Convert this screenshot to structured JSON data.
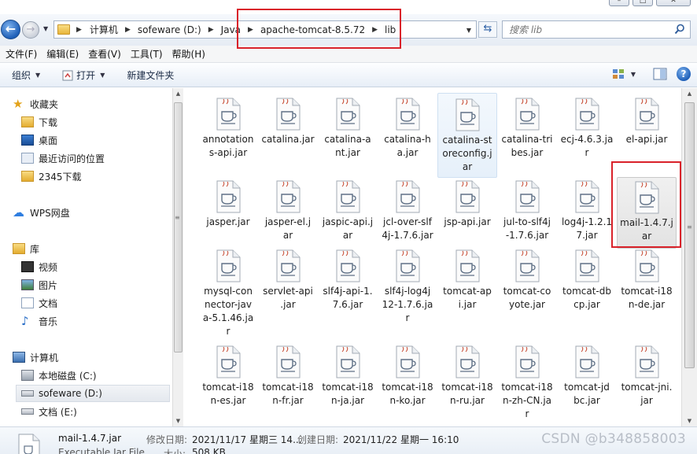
{
  "window": {
    "min_glyph": "–",
    "max_glyph": "□",
    "close_glyph": "✕"
  },
  "address": {
    "crumbs": [
      "计算机",
      "sofeware (D:)",
      "Java",
      "apache-tomcat-8.5.72",
      "lib"
    ],
    "search_placeholder": "搜索 lib"
  },
  "menu": [
    "文件(F)",
    "编辑(E)",
    "查看(V)",
    "工具(T)",
    "帮助(H)"
  ],
  "toolbar": {
    "organize": "组织",
    "open": "打开",
    "new_folder": "新建文件夹"
  },
  "nav": {
    "favorites": "收藏夹",
    "downloads": "下载",
    "desktop": "桌面",
    "recent": "最近访问的位置",
    "d2345": "2345下载",
    "wps": "WPS网盘",
    "libraries": "库",
    "videos": "视频",
    "pictures": "图片",
    "documents": "文档",
    "music": "音乐",
    "computer": "计算机",
    "drive_c": "本地磁盘 (C:)",
    "drive_d": "sofeware (D:)",
    "drive_e": "文档 (E:)"
  },
  "files": [
    "annotations-api.jar",
    "catalina.jar",
    "catalina-ant.jar",
    "catalina-ha.jar",
    "catalina-storeconfig.jar",
    "catalina-tribes.jar",
    "ecj-4.6.3.jar",
    "el-api.jar",
    "jasper.jar",
    "jasper-el.jar",
    "jaspic-api.jar",
    "jcl-over-slf4j-1.7.6.jar",
    "jsp-api.jar",
    "jul-to-slf4j-1.7.6.jar",
    "log4j-1.2.17.jar",
    "mail-1.4.7.jar",
    "mysql-connector-java-5.1.46.jar",
    "servlet-api.jar",
    "slf4j-api-1.7.6.jar",
    "slf4j-log4j12-1.7.6.jar",
    "tomcat-api.jar",
    "tomcat-coyote.jar",
    "tomcat-dbcp.jar",
    "tomcat-i18n-de.jar",
    "tomcat-i18n-es.jar",
    "tomcat-i18n-fr.jar",
    "tomcat-i18n-ja.jar",
    "tomcat-i18n-ko.jar",
    "tomcat-i18n-ru.jar",
    "tomcat-i18n-zh-CN.jar",
    "tomcat-jdbc.jar",
    "tomcat-jni.jar"
  ],
  "files_display": [
    [
      "annotation",
      "s-api.jar"
    ],
    [
      "catalina.jar"
    ],
    [
      "catalina-a",
      "nt.jar"
    ],
    [
      "catalina-h",
      "a.jar"
    ],
    [
      "catalina-st",
      "oreconfig.j",
      "ar"
    ],
    [
      "catalina-tri",
      "bes.jar"
    ],
    [
      "ecj-4.6.3.ja",
      "r"
    ],
    [
      "el-api.jar"
    ],
    [
      "jasper.jar"
    ],
    [
      "jasper-el.j",
      "ar"
    ],
    [
      "jaspic-api.j",
      "ar"
    ],
    [
      "jcl-over-slf",
      "4j-1.7.6.jar"
    ],
    [
      "jsp-api.jar"
    ],
    [
      "jul-to-slf4j",
      "-1.7.6.jar"
    ],
    [
      "log4j-1.2.1",
      "7.jar"
    ],
    [
      "mail-1.4.7.j",
      "ar"
    ],
    [
      "mysql-con",
      "nector-jav",
      "a-5.1.46.ja",
      "r"
    ],
    [
      "servlet-api",
      ".jar"
    ],
    [
      "slf4j-api-1.",
      "7.6.jar"
    ],
    [
      "slf4j-log4j",
      "12-1.7.6.ja",
      "r"
    ],
    [
      "tomcat-ap",
      "i.jar"
    ],
    [
      "tomcat-co",
      "yote.jar"
    ],
    [
      "tomcat-db",
      "cp.jar"
    ],
    [
      "tomcat-i18",
      "n-de.jar"
    ],
    [
      "tomcat-i18",
      "n-es.jar"
    ],
    [
      "tomcat-i18",
      "n-fr.jar"
    ],
    [
      "tomcat-i18",
      "n-ja.jar"
    ],
    [
      "tomcat-i18",
      "n-ko.jar"
    ],
    [
      "tomcat-i18",
      "n-ru.jar"
    ],
    [
      "tomcat-i18",
      "n-zh-CN.ja",
      "r"
    ],
    [
      "tomcat-jd",
      "bc.jar"
    ],
    [
      "tomcat-jni.",
      "jar"
    ]
  ],
  "selected_file": "mail-1.4.7.jar",
  "hover_file": "catalina-storeconfig.jar",
  "details": {
    "name": "mail-1.4.7.jar",
    "type": "Executable Jar File",
    "modified_label": "修改日期:",
    "modified_value": "2021/11/17 星期三 14...",
    "created_label": "创建日期:",
    "created_value": "2021/11/22 星期一 16:10",
    "size_label": "大小:",
    "size_value": "508 KB"
  },
  "watermark": "CSDN @b348858003",
  "colors": {
    "annotation": "#d9222a",
    "accent": "#1e5fb8"
  }
}
